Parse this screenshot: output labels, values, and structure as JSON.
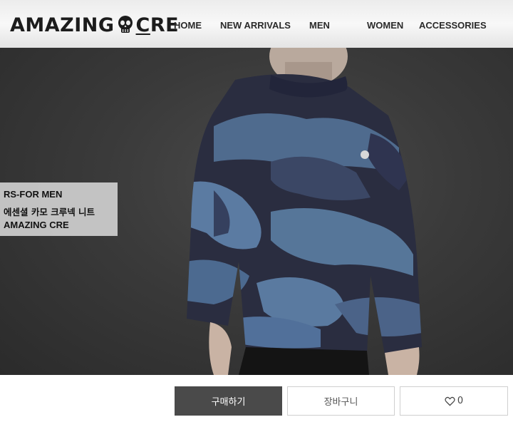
{
  "brand": {
    "part1": "AMAZING",
    "part2": "C",
    "part3": "RE"
  },
  "nav": [
    "HOME",
    "NEW ARRIVALS",
    "MEN",
    "WOMEN",
    "ACCESSORIES"
  ],
  "product": {
    "line1": "RS-FOR MEN",
    "line2": "에센셜 카모 크루넥 니트",
    "line3": "AMAZING CRE"
  },
  "actions": {
    "buy": "구매하기",
    "cart": "장바구니",
    "like_count": "0"
  },
  "icons": {
    "logo_mark": "skull-icon",
    "like": "heart-icon"
  }
}
